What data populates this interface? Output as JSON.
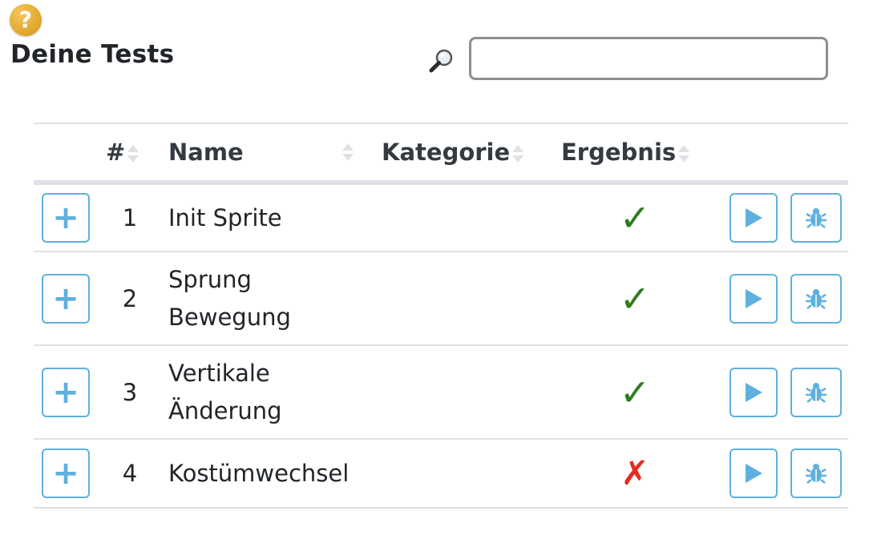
{
  "header": {
    "help_icon": "question-circle-icon",
    "help_glyph": "?",
    "title": "Deine Tests"
  },
  "search": {
    "icon": "magnifier-icon",
    "value": "",
    "placeholder": ""
  },
  "table": {
    "columns": [
      {
        "label": "#",
        "sortable": true
      },
      {
        "label": "Name",
        "sortable": true
      },
      {
        "label": "Kategorie",
        "sortable": true
      },
      {
        "label": "Ergebnis",
        "sortable": true
      }
    ],
    "rows": [
      {
        "number": "1",
        "name_lines": [
          "Init Sprite"
        ],
        "category": "",
        "result": "pass",
        "result_glyph": "✓"
      },
      {
        "number": "2",
        "name_lines": [
          "Sprung",
          "Bewegung"
        ],
        "category": "",
        "result": "pass",
        "result_glyph": "✓"
      },
      {
        "number": "3",
        "name_lines": [
          "Vertikale",
          "Änderung"
        ],
        "category": "",
        "result": "pass",
        "result_glyph": "✓"
      },
      {
        "number": "4",
        "name_lines": [
          "Kostümwechsel"
        ],
        "category": "",
        "result": "fail",
        "result_glyph": "✗"
      }
    ],
    "row_icons": {
      "expand": "plus-icon",
      "expand_glyph": "+",
      "run": "play-icon",
      "debug": "bug-icon"
    }
  },
  "colors": {
    "accent": "#5fb0de",
    "pass": "#2e7d1e",
    "fail": "#e52b20",
    "help": "#e0a52a"
  }
}
